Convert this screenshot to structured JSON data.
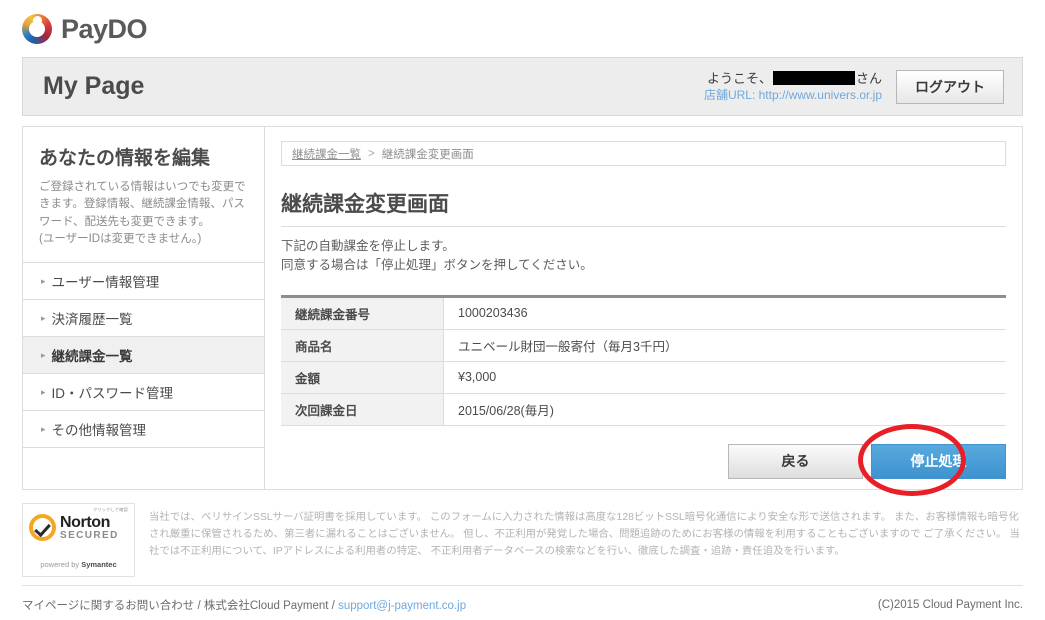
{
  "brand": {
    "name": "PayDO",
    "logo_colors": {
      "orange": "#e8a33d",
      "red": "#d4373f",
      "blue": "#1f5fa9"
    }
  },
  "header": {
    "title": "My Page",
    "welcome_prefix": "ようこそ、",
    "welcome_suffix": "さん",
    "shop_url_label": "店舗URL: http://www.univers.or.jp",
    "logout_label": "ログアウト"
  },
  "sidebar": {
    "title": "あなたの情報を編集",
    "description": "ご登録されている情報はいつでも変更できます。登録情報、継続課金情報、パスワード、配送先も変更できます。\n(ユーザーIDは変更できません。)",
    "bullet": "▸",
    "items": [
      {
        "label": "ユーザー情報管理",
        "active": false
      },
      {
        "label": "決済履歴一覧",
        "active": false
      },
      {
        "label": "継続課金一覧",
        "active": true
      },
      {
        "label": "ID・パスワード管理",
        "active": false
      },
      {
        "label": "その他情報管理",
        "active": false
      }
    ]
  },
  "main": {
    "breadcrumb": {
      "link": "継続課金一覧",
      "separator": ">",
      "current": "継続課金変更画面"
    },
    "heading": "継続課金変更画面",
    "lead": "下記の自動課金を停止します。\n同意する場合は「停止処理」ボタンを押してください。",
    "table": [
      {
        "label": "継続課金番号",
        "value": "1000203436"
      },
      {
        "label": "商品名",
        "value": "ユニベール財団一般寄付（毎月3千円）"
      },
      {
        "label": "金額",
        "value": "¥3,000"
      },
      {
        "label": "次回課金日",
        "value": "2015/06/28(毎月)"
      }
    ],
    "buttons": {
      "back": "戻る",
      "stop": "停止処理",
      "stop_color": "#3e93cf"
    },
    "annotation": {
      "shape": "red-circle",
      "color": "#e81f26",
      "target": "停止処理"
    }
  },
  "security": {
    "badge_tiny_text": "クリックして確認",
    "badge_name": "Norton",
    "badge_secured": "SECURED",
    "badge_powered_prefix": "powered by ",
    "badge_powered_brand": "Symantec",
    "legal_text": "当社では、ベリサインSSLサーバ証明書を採用しています。 このフォームに入力された情報は高度な128ビットSSL暗号化通信により安全な形で送信されます。 また、お客様情報も暗号化され厳重に保管されるため、第三者に漏れることはございません。 但し、不正利用が発覚した場合、問題追跡のためにお客様の情報を利用することもございますので ご了承ください。 当社では不正利用について、IPアドレスによる利用者の特定、 不正利用者データベースの検索などを行い、徹底した調査・追跡・責任追及を行います。"
  },
  "footer": {
    "contact_text": "マイページに関するお問い合わせ / 株式会社Cloud Payment / ",
    "email": "support@j-payment.co.jp",
    "copyright": "(C)2015 Cloud Payment Inc."
  }
}
